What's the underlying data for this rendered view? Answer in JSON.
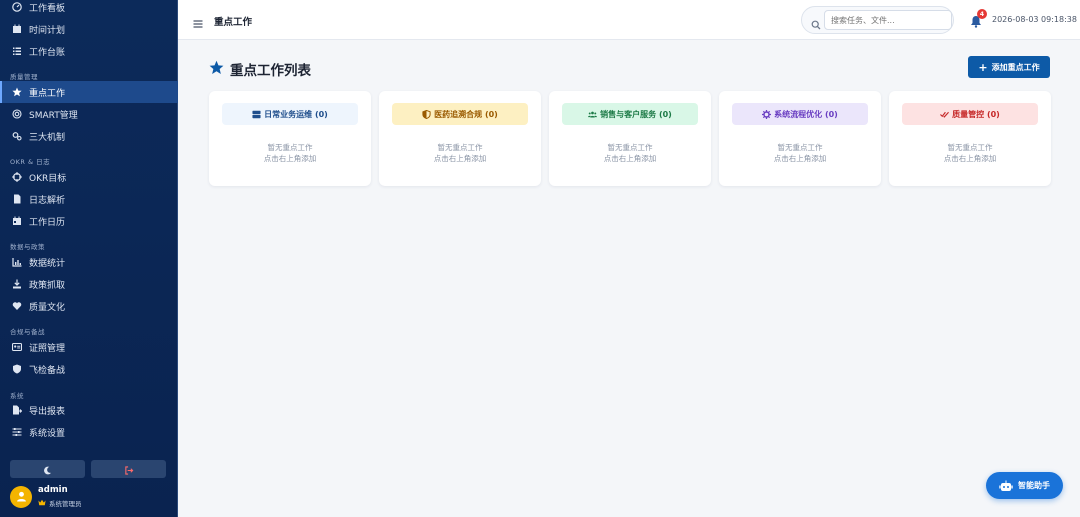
{
  "sidebar": {
    "items": [
      {
        "label": "工作看板",
        "icon": "gauge-icon"
      },
      {
        "label": "时间计划",
        "icon": "calendar-icon"
      },
      {
        "label": "工作台账",
        "icon": "list-icon"
      },
      {
        "label": "重点工作",
        "icon": "star-icon",
        "active": true
      },
      {
        "label": "SMART管理",
        "icon": "target-icon"
      },
      {
        "label": "三大机制",
        "icon": "gears-icon"
      },
      {
        "label": "OKR目标",
        "icon": "crosshair-icon"
      },
      {
        "label": "日志解析",
        "icon": "document-icon"
      },
      {
        "label": "工作日历",
        "icon": "calendar-day-icon"
      },
      {
        "label": "数据统计",
        "icon": "chart-icon"
      },
      {
        "label": "政策抓取",
        "icon": "download-icon"
      },
      {
        "label": "质量文化",
        "icon": "heart-icon"
      },
      {
        "label": "证照管理",
        "icon": "id-card-icon"
      },
      {
        "label": "飞检备战",
        "icon": "shield-icon"
      },
      {
        "label": "导出报表",
        "icon": "file-export-icon"
      },
      {
        "label": "系统设置",
        "icon": "sliders-icon"
      }
    ],
    "sections": [
      "质量管理",
      "OKR & 日志",
      "数据与政策",
      "合规与备战",
      "系统"
    ],
    "user": {
      "name": "admin",
      "role": "系统管理员"
    }
  },
  "header": {
    "title": "重点工作",
    "search_placeholder": "搜索任务、文件...",
    "notification_count": "4",
    "datetime": "2026-08-03 09:18:38"
  },
  "main": {
    "title": "重点工作列表",
    "add_button": "添加重点工作",
    "categories": [
      {
        "label": "日常业务运维 (0)",
        "icon": "server-icon",
        "bg": "#eef5fd",
        "color": "#1f4e8c"
      },
      {
        "label": "医药追溯合规 (0)",
        "icon": "shield-half-icon",
        "bg": "#fdf0c2",
        "color": "#9a5a00"
      },
      {
        "label": "销售与客户服务 (0)",
        "icon": "users-icon",
        "bg": "#d9f7e7",
        "color": "#1c7a46"
      },
      {
        "label": "系统流程优化 (0)",
        "icon": "cog-icon",
        "bg": "#ebe6fb",
        "color": "#6a3fc2"
      },
      {
        "label": "质量管控 (0)",
        "icon": "check-double-icon",
        "bg": "#fde2e2",
        "color": "#c62828"
      }
    ],
    "empty_line1": "暂无重点工作",
    "empty_line2": "点击右上角添加"
  },
  "assistant": {
    "label": "智能助手"
  }
}
